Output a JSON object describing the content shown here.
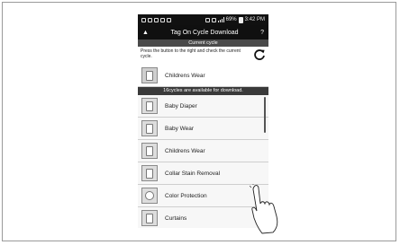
{
  "status_bar": {
    "battery": "69%",
    "time": "3:42 PM"
  },
  "title_bar": {
    "title": "Tag On Cycle Download",
    "help_label": "?"
  },
  "current_cycle": {
    "header": "Current cycle",
    "instruction": "Press the button to the right and check the current cycle.",
    "name": "Childrens Wear"
  },
  "download_banner": "16cycles are available for download.",
  "cycles": [
    {
      "label": "Baby Diaper",
      "icon": "diaper-icon"
    },
    {
      "label": "Baby Wear",
      "icon": "baby-shirt-icon"
    },
    {
      "label": "Childrens Wear",
      "icon": "children-clothes-icon"
    },
    {
      "label": "Collar Stain Removal",
      "icon": "shirt-collar-icon"
    },
    {
      "label": "Color Protection",
      "icon": "palette-icon"
    },
    {
      "label": "Curtains",
      "icon": "curtain-icon"
    }
  ]
}
